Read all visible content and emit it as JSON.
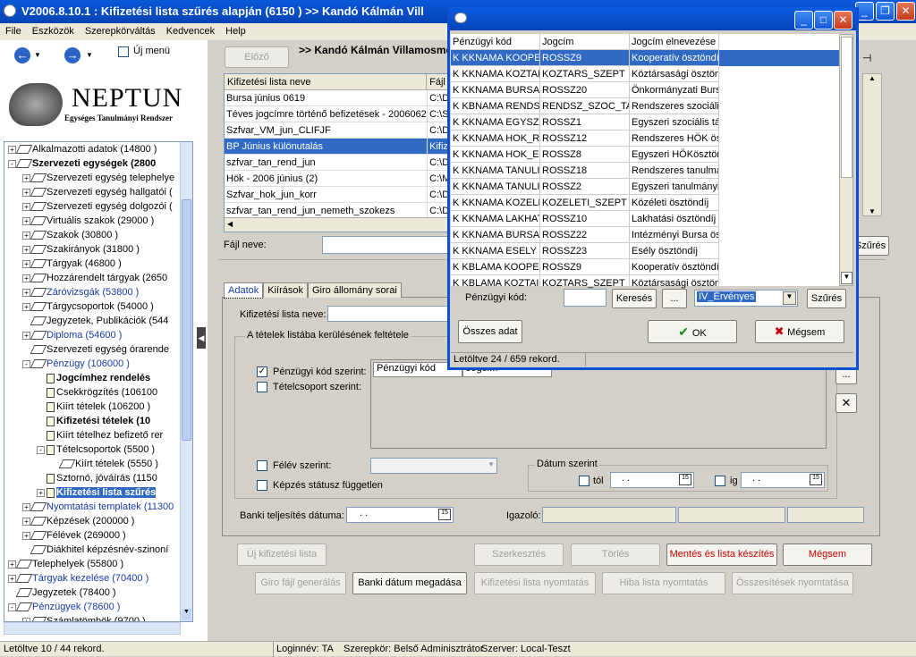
{
  "window": {
    "title": "V2006.8.10.1 : Kifizetési lista szűrés alapján (6150  )  >> Kandó Kálmán Vill"
  },
  "menu": [
    "File",
    "Eszközök",
    "Szerepkörváltás",
    "Kedvencek",
    "Help"
  ],
  "toolbar": {
    "new_menu": "Új menü"
  },
  "logo": {
    "name": "NEPTUN",
    "subtitle": "Egységes Tanulmányi Rendszer"
  },
  "tree": [
    {
      "label": "Alkalmazotti adatok (14800  )",
      "indent": 0,
      "exp": "+",
      "ico": "tag",
      "style": ""
    },
    {
      "label": "Szervezeti egységek (2800",
      "indent": 0,
      "exp": "-",
      "ico": "tag",
      "style": "bold"
    },
    {
      "label": "Szervezeti egység telephelye",
      "indent": 1,
      "exp": "+",
      "ico": "tag",
      "style": ""
    },
    {
      "label": "Szervezeti egység hallgatói (",
      "indent": 1,
      "exp": "+",
      "ico": "tag",
      "style": ""
    },
    {
      "label": "Szervezeti egység dolgozói (",
      "indent": 1,
      "exp": "+",
      "ico": "tag",
      "style": ""
    },
    {
      "label": "Virtuális szakok (29000  )",
      "indent": 1,
      "exp": "+",
      "ico": "tag",
      "style": ""
    },
    {
      "label": "Szakok (30800  )",
      "indent": 1,
      "exp": "+",
      "ico": "tag",
      "style": ""
    },
    {
      "label": "Szakirányok (31800  )",
      "indent": 1,
      "exp": "+",
      "ico": "tag",
      "style": ""
    },
    {
      "label": "Tárgyak (46800  )",
      "indent": 1,
      "exp": "+",
      "ico": "tag",
      "style": ""
    },
    {
      "label": "Hozzárendelt tárgyak (2650",
      "indent": 1,
      "exp": "+",
      "ico": "tag",
      "style": ""
    },
    {
      "label": "Záróvizsgák (53800  )",
      "indent": 1,
      "exp": "+",
      "ico": "tag",
      "style": "blue"
    },
    {
      "label": "Tárgycsoportok (54000  )",
      "indent": 1,
      "exp": "+",
      "ico": "tag",
      "style": ""
    },
    {
      "label": "Jegyzetek, Publikációk (544",
      "indent": 1,
      "exp": "",
      "ico": "tag",
      "style": ""
    },
    {
      "label": "Diploma (54600  )",
      "indent": 1,
      "exp": "+",
      "ico": "tag",
      "style": "blue"
    },
    {
      "label": "Szervezeti egység órarende",
      "indent": 1,
      "exp": "",
      "ico": "tag",
      "style": ""
    },
    {
      "label": "Pénzügy (106000  )",
      "indent": 1,
      "exp": "-",
      "ico": "tag",
      "style": "blue"
    },
    {
      "label": "Jogcímhez rendelés",
      "indent": 2,
      "exp": "",
      "ico": "doc",
      "style": "bold"
    },
    {
      "label": "Csekkrögzítés (106100",
      "indent": 2,
      "exp": "",
      "ico": "doc",
      "style": ""
    },
    {
      "label": "Kiírt tételek (106200  )",
      "indent": 2,
      "exp": "",
      "ico": "doc",
      "style": ""
    },
    {
      "label": "Kifizetési tételek (10",
      "indent": 2,
      "exp": "",
      "ico": "doc",
      "style": "bold"
    },
    {
      "label": "Kiírt tételhez befizető rer",
      "indent": 2,
      "exp": "",
      "ico": "doc",
      "style": ""
    },
    {
      "label": "Tételcsoportok (5500  )",
      "indent": 2,
      "exp": "-",
      "ico": "doc",
      "style": ""
    },
    {
      "label": "Kiírt tételek (5550  )",
      "indent": 3,
      "exp": "",
      "ico": "tag",
      "style": ""
    },
    {
      "label": "Sztornó, jóváírás (1150",
      "indent": 2,
      "exp": "",
      "ico": "doc",
      "style": ""
    },
    {
      "label": "Kifizetési lista szűrés",
      "indent": 2,
      "exp": "+",
      "ico": "doc",
      "style": "selbold"
    },
    {
      "label": "Nyomtatási templatek (11300",
      "indent": 1,
      "exp": "+",
      "ico": "tag",
      "style": "blue"
    },
    {
      "label": "Képzések (200000  )",
      "indent": 1,
      "exp": "+",
      "ico": "tag",
      "style": ""
    },
    {
      "label": "Félévek (269000  )",
      "indent": 1,
      "exp": "+",
      "ico": "tag",
      "style": ""
    },
    {
      "label": "Diákhitel képzésnév-szinoní",
      "indent": 1,
      "exp": "",
      "ico": "tag",
      "style": ""
    },
    {
      "label": "Telephelyek (55800  )",
      "indent": 0,
      "exp": "+",
      "ico": "tag",
      "style": ""
    },
    {
      "label": "Tárgyak kezelése (70400  )",
      "indent": 0,
      "exp": "+",
      "ico": "tag",
      "style": "blue"
    },
    {
      "label": "Jegyzetek (78400  )",
      "indent": 0,
      "exp": "",
      "ico": "tag",
      "style": ""
    },
    {
      "label": "Pénzügyek (78600  )",
      "indent": 0,
      "exp": "-",
      "ico": "tag",
      "style": "blue"
    },
    {
      "label": "Számlatömbök (9700  )",
      "indent": 1,
      "exp": "+",
      "ico": "tag",
      "style": ""
    }
  ],
  "main": {
    "prev_button": "Előző",
    "header": ">> Kandó Kálmán Villamosmérnöki",
    "list_headers": [
      "Kifizetési lista neve",
      "Fájl"
    ],
    "list_rows": [
      [
        "Bursa június 0619",
        "C:\\D"
      ],
      [
        "Téves jogcímre történő befizetések - 20060620",
        "C:\\S"
      ],
      [
        "Szfvar_VM_jun_CLIFJF",
        "C:\\D"
      ],
      [
        "BP Június különutalás",
        "Kifiz"
      ],
      [
        "szfvar_tan_rend_jun",
        "C:\\D"
      ],
      [
        "Hök - 2006 június (2)",
        "C:\\M"
      ],
      [
        "Szfvar_hok_jun_korr",
        "C:\\D"
      ],
      [
        "szfvar_tan_rend_jun_nemeth_szokezs",
        "C:\\D"
      ]
    ],
    "file_label": "Fájl neve:",
    "filter_button": "Szűrés",
    "tabs": [
      "Adatok",
      "Kiírások",
      "Giro állomány sorai"
    ],
    "list_name_label": "Kifizetési lista neve:",
    "conditions_group": "A tételek listába kerülésének feltétele",
    "cb_penzugyi": "Pénzügyi kód szerint:",
    "cb_tetelcsoport": "Tételcsoport szerint:",
    "inner_grid_headers": [
      "Pénzügyi kód",
      "Jogcím"
    ],
    "cb_felev": "Félév szerint:",
    "cb_kepzes": "Képzés státusz független",
    "date_group": "Dátum szerint",
    "tol_label": "tól",
    "ig_label": "ig",
    "date_placeholder": ". .",
    "bank_date_label": "Banki teljesítés dátuma:",
    "igazolo_label": "Igazoló:",
    "buttons_row1": [
      "Új kifizetési lista",
      "Szerkesztés",
      "Törlés",
      "Mentés és lista készítés",
      "Mégsem"
    ],
    "buttons_row2": [
      "Giro fájl generálás",
      "Banki dátum megadása",
      "Kifizetési lista nyomtatás",
      "Hiba lista nyomtatás",
      "Összesítések nyomtatása"
    ]
  },
  "dialog": {
    "headers": [
      "Pénzügyi kód",
      "Jogcím",
      "Jogcím elnevezése"
    ],
    "rows": [
      [
        "K KKNAMA KOOPE",
        "ROSSZ9",
        "Kooperatív ösztöndí"
      ],
      [
        "K KKNAMA KOZTAI",
        "KOZTARS_SZEPT",
        "Köztársasági ösztön"
      ],
      [
        "K KKNAMA BURSA",
        "ROSSZ20",
        "Önkormányzati Bursa"
      ],
      [
        "K KBNAMA RENDS",
        "RENDSZ_SZOC_TA",
        "Rendszeres szociális"
      ],
      [
        "K KKNAMA EGYSZI",
        "ROSSZ1",
        "Egyszeri szociális tár"
      ],
      [
        "K KKNAMA HOK_R",
        "ROSSZ12",
        "Rendszeres HÖK ös"
      ],
      [
        "K KKNAMA HOK_EI",
        "ROSSZ8",
        "Egyszeri HÖKösztör"
      ],
      [
        "K KKNAMA TANULI",
        "ROSSZ18",
        "Rendszeres tanulmá"
      ],
      [
        "K KKNAMA TANULI",
        "ROSSZ2",
        "Egyszeri tanulmányi"
      ],
      [
        "K KKNAMA KOZELI",
        "KOZELETI_SZEPT",
        "Közéleti ösztöndíj"
      ],
      [
        "K KKNAMA LAKHAT",
        "ROSSZ10",
        "Lakhatási ösztöndíj"
      ],
      [
        "K KKNAMA BURSA",
        "ROSSZ22",
        "Intézményi Bursa ös"
      ],
      [
        "K KKNAMA ESELY",
        "ROSSZ23",
        "Esély ösztöndíj"
      ],
      [
        "K KBLAMA KOOPE",
        "ROSSZ9",
        "Kooperatív ösztöndí"
      ],
      [
        "K KBLAMA KOZTAI",
        "KOZTARS_SZEPT",
        "Köztársasági ösztön"
      ]
    ],
    "code_label": "Pénzügyi kód:",
    "search_button": "Keresés",
    "ellipsis_button": "...",
    "select_value": "IV_Érvényes",
    "filter_button": "Szűrés",
    "all_button": "Összes adat",
    "ok_button": "OK",
    "cancel_button": "Mégsem",
    "status": "Letöltve 24 / 659 rekord."
  },
  "statusbar": {
    "left": "Letöltve 10 / 44 rekord.",
    "login": "Loginnév: TA",
    "role": "Szerepkör: Belső Adminisztrátor",
    "server": "Szerver: Local-Teszt"
  }
}
